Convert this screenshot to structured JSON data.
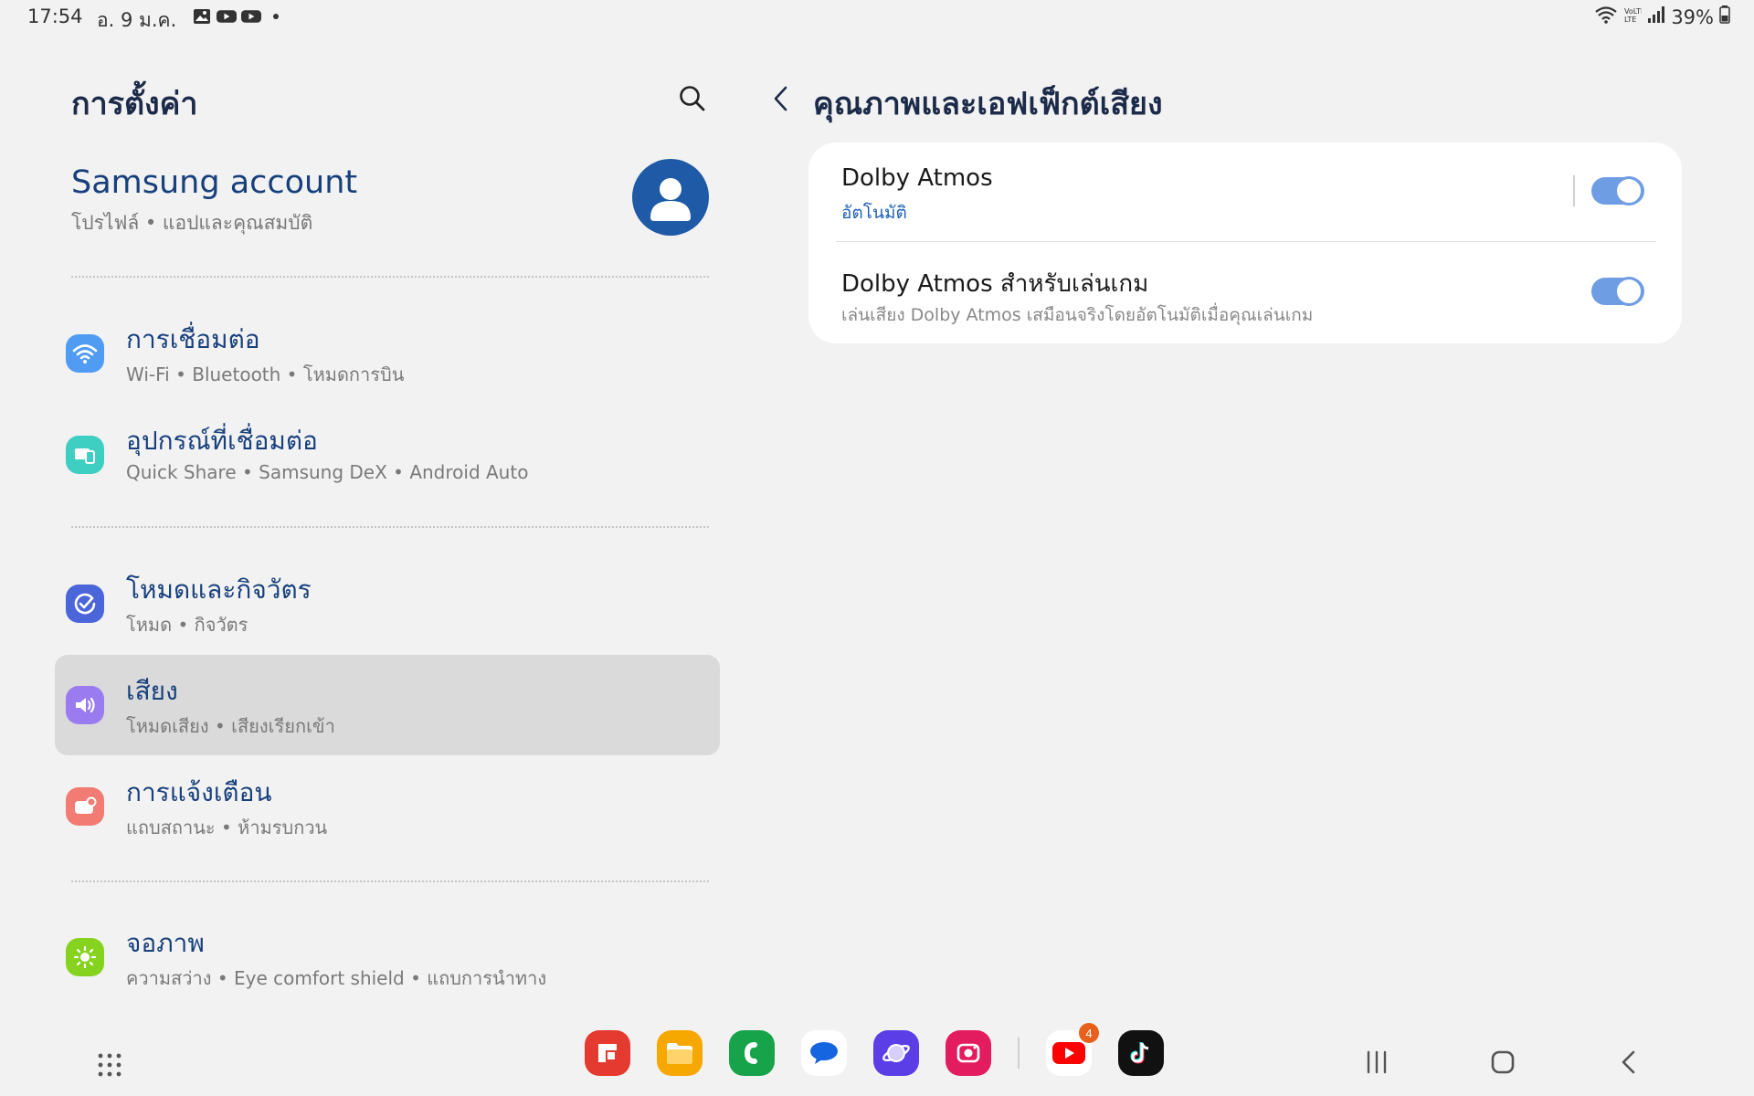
{
  "status_bar": {
    "time": "17:54",
    "date": "อ. 9 ม.ค.",
    "notification_icons": [
      "gallery-icon",
      "youtube-icon",
      "youtube-icon",
      "dot-icon"
    ],
    "battery": "39%"
  },
  "left_pane": {
    "title": "การตั้งค่า",
    "account": {
      "title": "Samsung account",
      "subtitle": "โปรไฟล์ • แอปและคุณสมบัติ"
    },
    "items": [
      {
        "title": "การเชื่อมต่อ",
        "subtitle": "Wi-Fi • Bluetooth • โหมดการบิน",
        "icon": "wifi-icon",
        "color": "#4f9cf2"
      },
      {
        "title": "อุปกรณ์ที่เชื่อมต่อ",
        "subtitle": "Quick Share • Samsung DeX • Android Auto",
        "icon": "devices-icon",
        "color": "#3ecfc2"
      },
      {
        "title": "โหมดและกิจวัตร",
        "subtitle": "โหมด • กิจวัตร",
        "icon": "modes-icon",
        "color": "#4b66d9"
      },
      {
        "title": "เสียง",
        "subtitle": "โหมดเสียง • เสียงเรียกเข้า",
        "icon": "volume-icon",
        "color": "#9a7cf0",
        "selected": true
      },
      {
        "title": "การแจ้งเตือน",
        "subtitle": "แถบสถานะ • ห้ามรบกวน",
        "icon": "notification-icon",
        "color": "#f27b73"
      },
      {
        "title": "จอภาพ",
        "subtitle": "ความสว่าง • Eye comfort shield • แถบการนำทาง",
        "icon": "brightness-icon",
        "color": "#86d31f"
      }
    ]
  },
  "right_pane": {
    "title": "คุณภาพและเอฟเฟ็กต์เสียง",
    "settings": [
      {
        "title": "Dolby Atmos",
        "subtitle": "อัตโนมัติ",
        "enabled": true
      },
      {
        "title": "Dolby Atmos สำหรับเล่นเกม",
        "subtitle": "เล่นเสียง Dolby Atmos เสมือนจริงโดยอัตโนมัติเมื่อคุณเล่นเกม",
        "enabled": true
      }
    ]
  },
  "nav_bar": {
    "dock_apps": [
      "flipboard-icon",
      "my-files-icon",
      "phone-icon",
      "messages-icon",
      "internet-icon",
      "screen-recorder-icon",
      "youtube-icon",
      "tiktok-icon"
    ],
    "youtube_badge": "4",
    "colors": {
      "accent": "#17407d",
      "toggle": "#6e9de4"
    }
  }
}
